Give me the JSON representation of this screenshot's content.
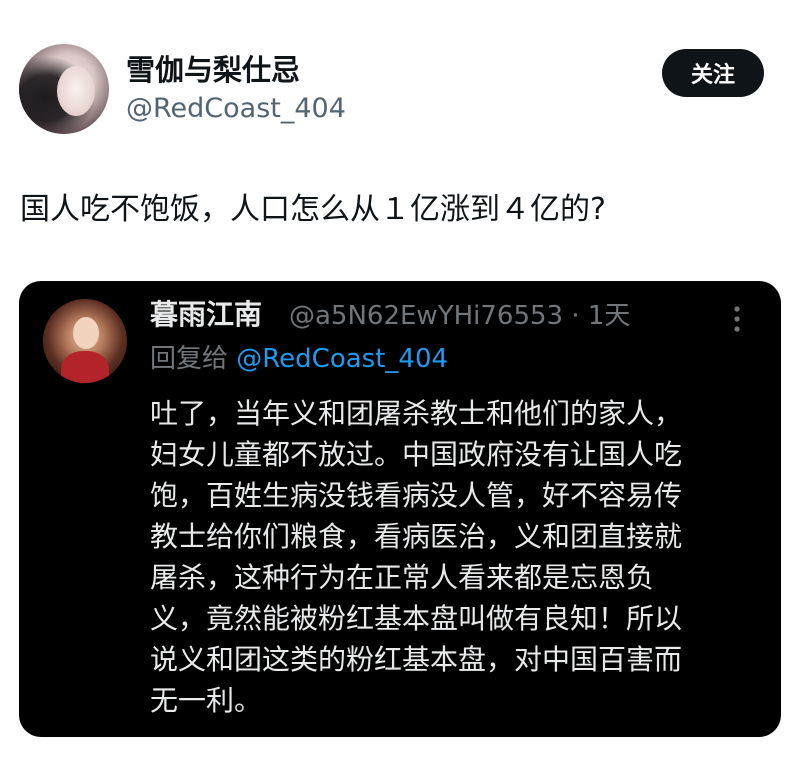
{
  "author": {
    "display_name": "雪伽与梨仕忌",
    "handle": "@RedCoast_404",
    "follow_label": "关注"
  },
  "tweet": {
    "text": "国人吃不饱饭，人口怎么从１亿涨到４亿的?"
  },
  "quoted": {
    "display_name": "暮雨江南",
    "meta": "@a5N62EwYHi76553 · 1天",
    "reply_prefix": "回复给 ",
    "reply_mention": "@RedCoast_404",
    "lines": [
      "吐了，当年义和团屠杀教士和他们的家人，",
      "妇女儿童都不放过。中国政府没有让国人吃",
      "饱，百姓生病没钱看病没人管，好不容易传",
      "教士给你们粮食，看病医治，义和团直接就",
      "屠杀，这种行为在正常人看来都是忘恩负",
      "义，竟然能被粉红基本盘叫做有良知！所以",
      "说义和团这类的粉红基本盘，对中国百害而",
      "无一利。"
    ]
  },
  "icons": {
    "more": "more-vertical-icon"
  },
  "colors": {
    "background": "#ffffff",
    "card_background": "#000000",
    "mention": "#1d9bf0",
    "secondary_text": "#536471"
  }
}
